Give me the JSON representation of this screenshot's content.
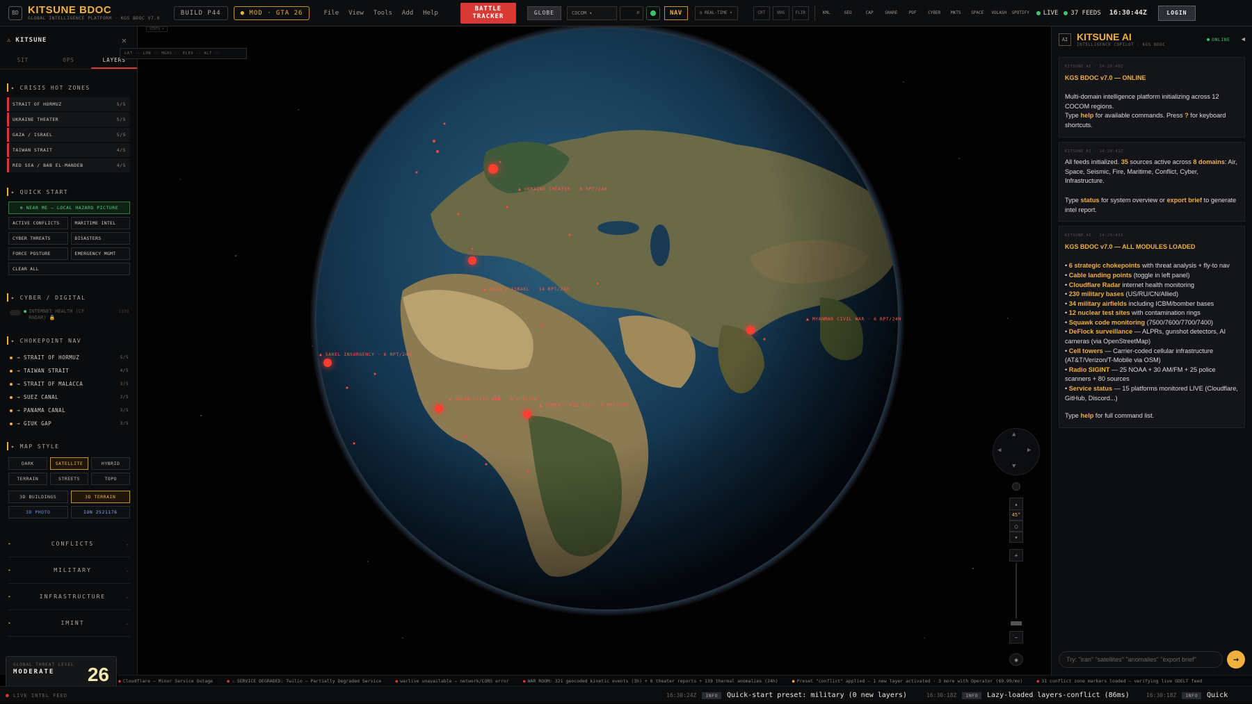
{
  "app": {
    "logo": "BD",
    "title": "KITSUNE BDOC",
    "subtitle": "GLOBAL INTELLIGENCE PLATFORM · KGS BDOC V7.0",
    "build": "BUILD P44",
    "mod": "● MOD · GTA 26"
  },
  "menu": [
    "File",
    "View",
    "Tools",
    "Add",
    "Help"
  ],
  "toolbar": {
    "battle_tracker": [
      "BATTLE",
      "TRACKER"
    ],
    "globe": "GLOBE",
    "cocom": "COCOM ▾",
    "search_icon": "⌕",
    "nav": "NAV",
    "realtime": "◷ REAL-TIME  ▾",
    "layers": [
      "CRT",
      "NVG",
      "FLIR"
    ],
    "tools": [
      "KML",
      "GEO",
      "CAP",
      "SHARE",
      "PDF",
      "CYBER",
      "MKTS",
      "SPACE",
      "VOLASH",
      "SPOTIFY"
    ],
    "live": "LIVE",
    "feeds": "37 FEEDS",
    "clock": "16:30:44Z",
    "login": "LOGIN"
  },
  "left": {
    "header": "KITSUNE",
    "close": "✕",
    "tabs": [
      "SIT",
      "OPS",
      "LAYERS"
    ],
    "crisis_title": "CRISIS HOT ZONES",
    "hot_zones": [
      {
        "label": "STRAIT OF HORMUZ",
        "score": "5/5"
      },
      {
        "label": "UKRAINE THEATER",
        "score": "5/5"
      },
      {
        "label": "GAZA / ISRAEL",
        "score": "5/5"
      },
      {
        "label": "TAIWAN STRAIT",
        "score": "4/5"
      },
      {
        "label": "RED SEA / BAB EL-MANDEB",
        "score": "4/5"
      }
    ],
    "quick_title": "QUICK START",
    "near_me": "⊕ NEAR ME — LOCAL HAZARD PICTURE",
    "quick": [
      "ACTIVE CONFLICTS",
      "MARITIME INTEL",
      "CYBER THREATS",
      "DISASTERS",
      "FORCE POSTURE",
      "EMERGENCY MGMT",
      "CLEAR ALL"
    ],
    "cyber_title": "CYBER / DIGITAL",
    "internet_health": "INTERNET HEALTH (CF RADAR) 🔒",
    "internet_count": "1339",
    "chokepoint_title": "CHOKEPOINT NAV",
    "chokepoints": [
      {
        "label": "STRAIT OF HORMUZ",
        "score": "5/5"
      },
      {
        "label": "TAIWAN STRAIT",
        "score": "4/5"
      },
      {
        "label": "STRAIT OF MALACCA",
        "score": "3/5"
      },
      {
        "label": "SUEZ CANAL",
        "score": "3/5"
      },
      {
        "label": "PANAMA CANAL",
        "score": "3/5"
      },
      {
        "label": "GIUK GAP",
        "score": "3/5"
      }
    ],
    "mapstyle_title": "MAP STYLE",
    "styles": [
      "DARK",
      "SATELLITE",
      "HYBRID",
      "TERRAIN",
      "STREETS",
      "TOPO"
    ],
    "extra": [
      "3D BUILDINGS",
      "3D TERRAIN",
      "3D PHOTO",
      "ION 2521176"
    ],
    "groups": [
      "CONFLICTS",
      "MILITARY",
      "INFRASTRUCTURE",
      "IMINT"
    ],
    "threat_label": "GLOBAL THREAT LEVEL",
    "threat_value": "MODERATE",
    "threat_score": "26",
    "threat_fill": 0.26,
    "live_intel": "LIVE INTEL FEED"
  },
  "map": {
    "coords": "LAT --  LON --  MGRS --  ELEV --  ALT --",
    "stats": "STATS ▾",
    "labels": [
      {
        "text": "▲ UKRAINE THEATER · 8 RPT/24H"
      },
      {
        "text": "▲ GAZA / ISRAEL · 14 RPT/24H"
      },
      {
        "text": "▲ SAHEL INSURGENCY · 6 RPT/24H"
      },
      {
        "text": "▲ SUDAN CIVIL WAR · 9 RPT/24H"
      },
      {
        "text": "▲ YEMEN / RED SEA · 5 RPT/24H"
      },
      {
        "text": "▲ MYANMAR CIVIL WAR · 6 RPT/24H"
      }
    ],
    "compass": "45°"
  },
  "ai": {
    "badge": "AI",
    "title": "KITSUNE AI",
    "subtitle": "INTELLIGENCE COPILOT · KGS BDOC",
    "status": "ONLINE",
    "collapse": "◀",
    "messages": [
      {
        "ts": "KITSUNE AI · 14:29:40Z",
        "head": "KGS BDOC v7.0 — ONLINE",
        "p1": "Multi-domain intelligence platform initializing across 12 COCOM regions.",
        "p2a": "Type ",
        "p2b": "help",
        "p2c": " for available commands. Press ",
        "p2d": "?",
        "p2e": " for keyboard shortcuts."
      },
      {
        "ts": "KITSUNE AI · 14:29:41Z",
        "p1a": "All feeds initialized. ",
        "p1b": "35",
        "p1c": " sources active across ",
        "p1d": "8 domains",
        "p1e": ": Air, Space, Seismic, Fire, Maritime, Conflict, Cyber, Infrastructure.",
        "p2a": "Type ",
        "p2b": "status",
        "p2c": " for system overview or ",
        "p2d": "export brief",
        "p2e": " to generate intel report."
      },
      {
        "ts": "KITSUNE AI · 14:29:43Z",
        "head": "KGS BDOC v7.0 — ALL MODULES LOADED",
        "bullets": [
          {
            "h": "6 strategic chokepoints",
            "t": " with threat analysis + fly-to nav"
          },
          {
            "h": "Cable landing points",
            "t": " (toggle in left panel)"
          },
          {
            "h": "Cloudflare Radar",
            "t": " internet health monitoring"
          },
          {
            "h": "230 military bases",
            "t": " (US/RU/CN/Allied)"
          },
          {
            "h": "34 military airfields",
            "t": " including ICBM/bomber bases"
          },
          {
            "h": "12 nuclear test sites",
            "t": " with contamination rings"
          },
          {
            "h": "Squawk code monitoring",
            "t": " (7500/7600/7700/7400)"
          },
          {
            "h": "DeFlock surveillance",
            "t": " — ALPRs, gunshot detectors, AI cameras (via OpenStreetMap)"
          },
          {
            "h": "Cell towers",
            "t": " — Carrier-coded cellular infrastructure (AT&T/Verizon/T-Mobile via OSM)"
          },
          {
            "h": "Radio SIGINT",
            "t": " — 25 NOAA + 30 AM/FM + 25 police scanners + 80 sources"
          },
          {
            "h": "Service status",
            "t": " — 15 platforms monitored LIVE (Cloudflare, GitHub, Discord...)"
          }
        ],
        "foot_a": "Type ",
        "foot_b": "help",
        "foot_c": " for full command list."
      }
    ],
    "input_placeholder": "Try: \"iran\" \"satellites\" \"anomalies\" \"export brief\"",
    "send": "→"
  },
  "ticker": [
    "Cloudflare — Minor Service Outage",
    "SERVICE DEGRADED: Twilio — Partially Degraded Service",
    "warlive unavailable — network/CORS error",
    "WAR ROOM: 321 geocoded kinetic events (3h) + 8 theater reports + 139 thermal anomalies (24h)",
    "Preset \"conflict\" applied — 1 new layer activated · 3 more with Operator ($9.99/mo)",
    "31 conflict zone markers loaded — verifying live GDELT feed"
  ],
  "status": [
    {
      "time": "16:30:24Z",
      "level": "INFO",
      "text": "Quick-start preset: military (0 new layers)"
    },
    {
      "time": "16:30:18Z",
      "level": "INFO",
      "text": "Lazy-loaded layers-conflict (86ms)"
    },
    {
      "time": "16:30:18Z",
      "level": "INFO",
      "text": "Quick"
    }
  ]
}
